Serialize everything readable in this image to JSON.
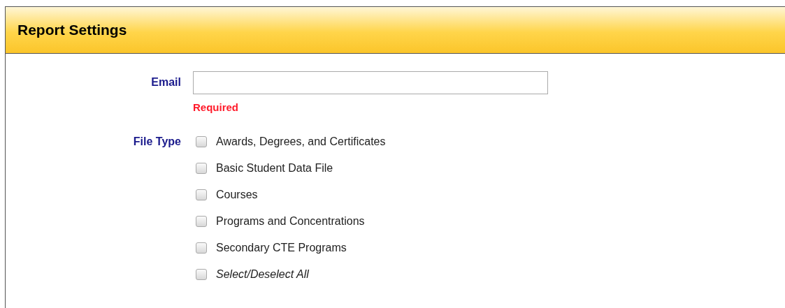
{
  "panel": {
    "title": "Report Settings"
  },
  "email": {
    "label": "Email",
    "error": "Required"
  },
  "file_type": {
    "label": "File Type",
    "options": [
      {
        "label": "Awards, Degrees, and Certificates",
        "checked": false,
        "kind": "option"
      },
      {
        "label": "Basic Student Data File",
        "checked": false,
        "kind": "option"
      },
      {
        "label": "Courses",
        "checked": false,
        "kind": "option"
      },
      {
        "label": "Programs and Concentrations",
        "checked": false,
        "kind": "option"
      },
      {
        "label": "Secondary CTE Programs",
        "checked": false,
        "kind": "option"
      },
      {
        "label": "Select/Deselect All",
        "checked": false,
        "kind": "select-all"
      }
    ]
  }
}
